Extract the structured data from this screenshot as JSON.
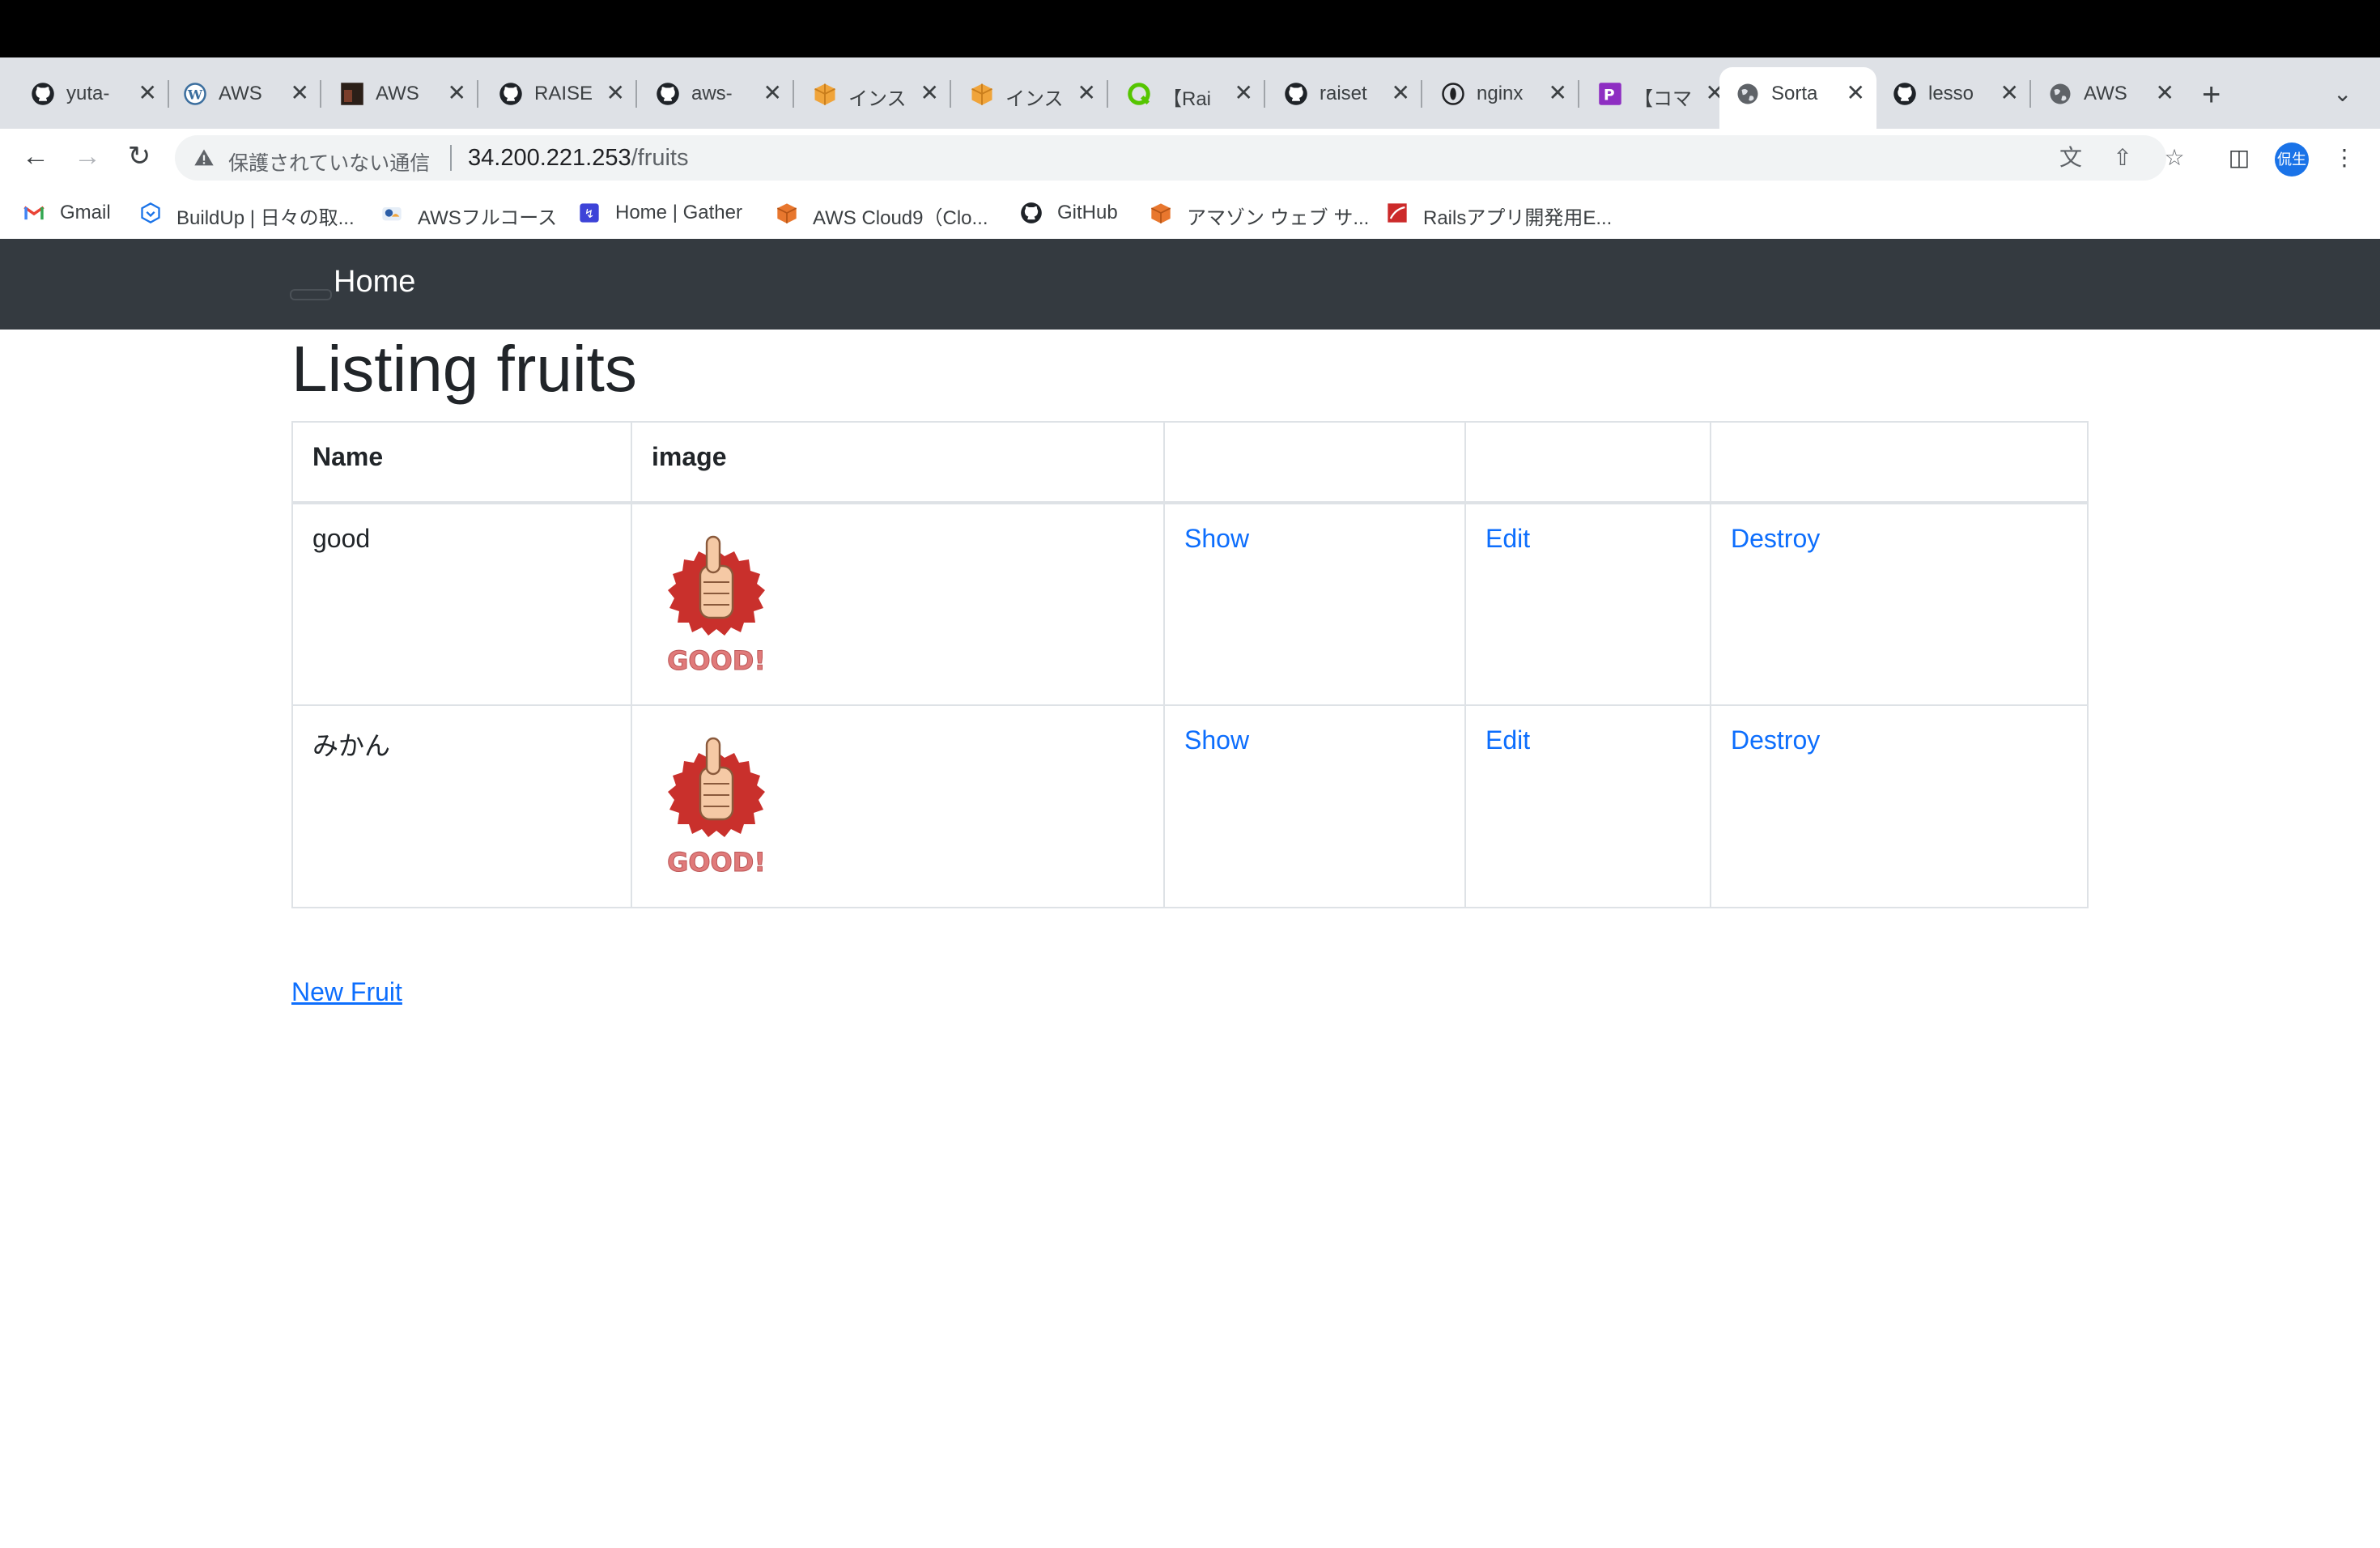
{
  "browser": {
    "tabs": [
      {
        "title": "yuta-",
        "favicon": "github-icon"
      },
      {
        "title": "AWS",
        "favicon": "wordpress-icon"
      },
      {
        "title": "AWS",
        "favicon": "dark-thumbnail-icon"
      },
      {
        "title": "RAISE",
        "favicon": "github-icon"
      },
      {
        "title": "aws-",
        "favicon": "github-icon"
      },
      {
        "title": "インス",
        "favicon": "package-icon"
      },
      {
        "title": "インス",
        "favicon": "package-icon"
      },
      {
        "title": "【Rai",
        "favicon": "green-q-icon"
      },
      {
        "title": "raiset",
        "favicon": "github-icon"
      },
      {
        "title": "nginx",
        "favicon": "info-circle-icon"
      },
      {
        "title": "【コマ",
        "favicon": "purple-p-icon"
      },
      {
        "title": "Sorta",
        "favicon": "globe-icon",
        "active": true
      },
      {
        "title": "lesso",
        "favicon": "github-icon"
      },
      {
        "title": "AWS",
        "favicon": "globe-icon"
      }
    ],
    "security_label": "保護されていない通信",
    "url_host": "34.200.221.253",
    "url_path": "/fruits",
    "avatar_text": "侃生",
    "bookmarks": [
      {
        "label": "Gmail",
        "icon": "gmail-icon"
      },
      {
        "label": "BuildUp | 日々の取...",
        "icon": "buildup-icon"
      },
      {
        "label": "AWSフルコース",
        "icon": "aws-course-icon"
      },
      {
        "label": "Home | Gather",
        "icon": "gather-icon"
      },
      {
        "label": "AWS Cloud9（Clo...",
        "icon": "aws-cube-icon"
      },
      {
        "label": "GitHub",
        "icon": "github-icon"
      },
      {
        "label": "アマゾン ウェブ サ...",
        "icon": "aws-cube-icon"
      },
      {
        "label": "Railsアプリ開発用E...",
        "icon": "rails-icon"
      }
    ]
  },
  "page": {
    "brand": "Home",
    "title": "Listing fruits",
    "columns": [
      "Name",
      "image",
      "",
      "",
      ""
    ],
    "rows": [
      {
        "name": "good",
        "image_text": "GOOD!",
        "show": "Show",
        "edit": "Edit",
        "destroy": "Destroy"
      },
      {
        "name": "みかん",
        "image_text": "GOOD!",
        "show": "Show",
        "edit": "Edit",
        "destroy": "Destroy"
      }
    ],
    "new_link": "New Fruit"
  }
}
